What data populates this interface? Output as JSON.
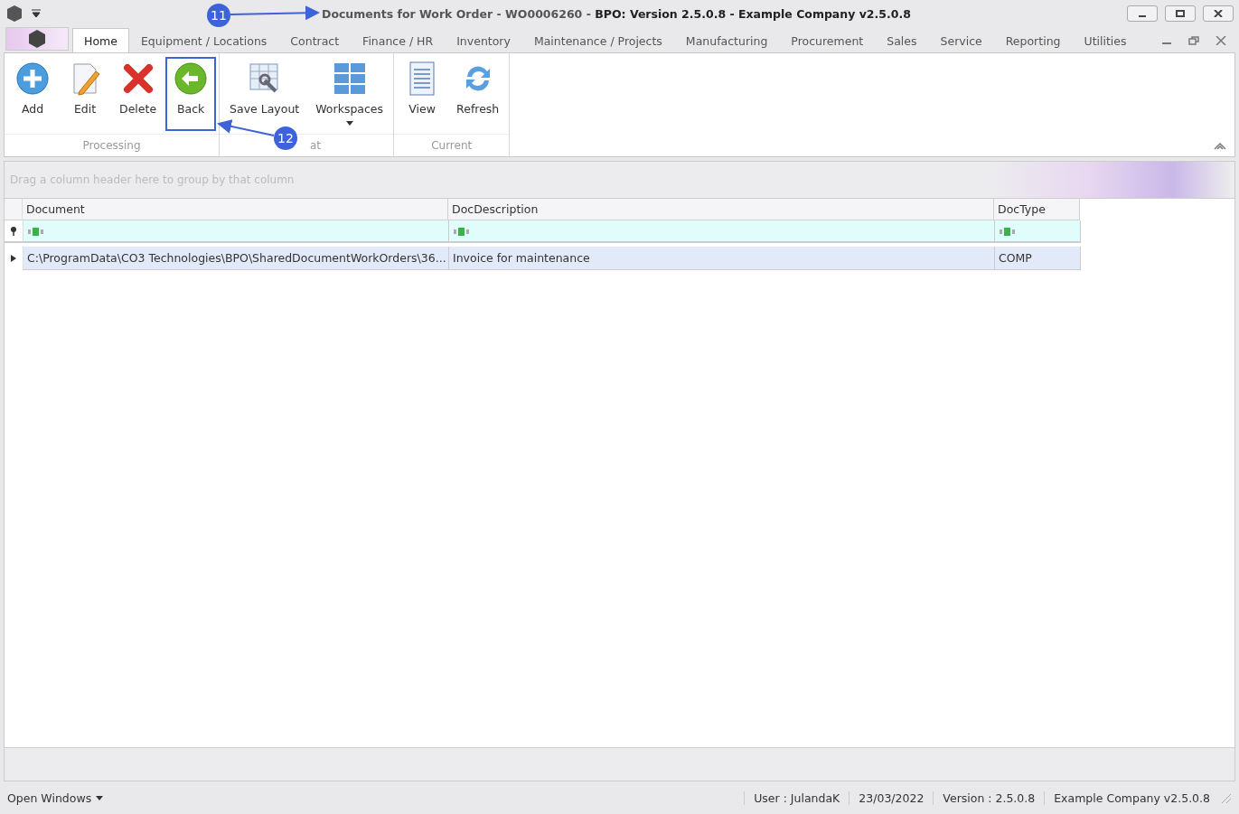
{
  "window": {
    "title": "Documents for Work Order - WO0006260 - ",
    "title_bold": "BPO: Version 2.5.0.8 - Example Company v2.5.0.8"
  },
  "tabs": [
    {
      "label": "Home",
      "selected": true
    },
    {
      "label": "Equipment / Locations",
      "selected": false
    },
    {
      "label": "Contract",
      "selected": false
    },
    {
      "label": "Finance / HR",
      "selected": false
    },
    {
      "label": "Inventory",
      "selected": false
    },
    {
      "label": "Maintenance / Projects",
      "selected": false
    },
    {
      "label": "Manufacturing",
      "selected": false
    },
    {
      "label": "Procurement",
      "selected": false
    },
    {
      "label": "Sales",
      "selected": false
    },
    {
      "label": "Service",
      "selected": false
    },
    {
      "label": "Reporting",
      "selected": false
    },
    {
      "label": "Utilities",
      "selected": false
    }
  ],
  "ribbon_groups": [
    {
      "label": "Processing",
      "buttons": [
        {
          "label": "Add",
          "kind": "add",
          "highlighted": false
        },
        {
          "label": "Edit",
          "kind": "edit",
          "highlighted": false
        },
        {
          "label": "Delete",
          "kind": "delete",
          "highlighted": false
        },
        {
          "label": "Back",
          "kind": "back",
          "highlighted": true
        }
      ]
    },
    {
      "label": "at",
      "buttons": [
        {
          "label": "Save Layout",
          "kind": "layout",
          "highlighted": false
        },
        {
          "label": "Workspaces",
          "kind": "workspaces",
          "highlighted": false,
          "dropdown": true
        }
      ]
    },
    {
      "label": "Current",
      "buttons": [
        {
          "label": "View",
          "kind": "view",
          "highlighted": false
        },
        {
          "label": "Refresh",
          "kind": "refresh",
          "highlighted": false
        }
      ]
    }
  ],
  "group_panel": {
    "hint": "Drag a column header here to group by that column"
  },
  "table": {
    "columns": [
      "Document",
      "DocDescription",
      "DocType"
    ],
    "rows": [
      {
        "cells": [
          "C:\\ProgramData\\CO3 Technologies\\BPO\\SharedDocumentWorkOrders\\36...",
          "Invoice for maintenance",
          "COMP"
        ],
        "selected": true
      }
    ]
  },
  "status_bar": {
    "open_windows": "Open Windows",
    "items": [
      "User : JulandaK",
      "23/03/2022",
      "Version : 2.5.0.8",
      "Example Company v2.5.0.8"
    ]
  },
  "callouts": [
    {
      "number": "11"
    },
    {
      "number": "12"
    }
  ]
}
